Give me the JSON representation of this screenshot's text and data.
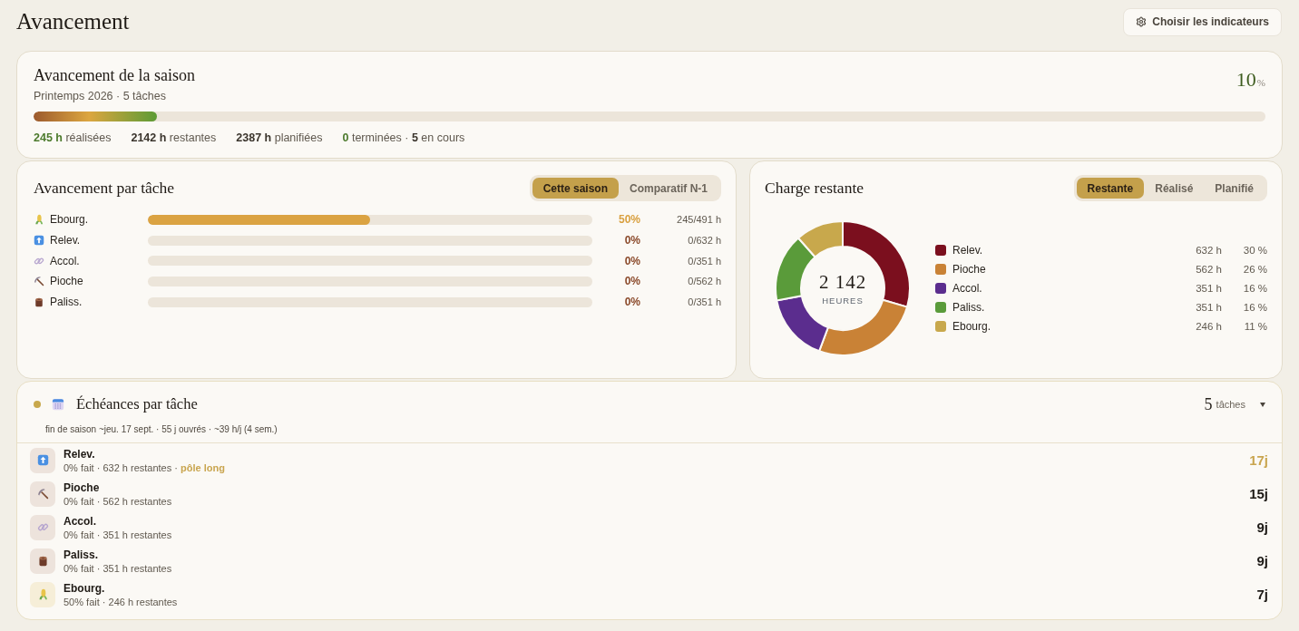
{
  "page": {
    "title": "Avancement",
    "action": "Choisir les indicateurs"
  },
  "season": {
    "title": "Avancement de la saison",
    "subtitle": "Printemps 2026 · 5 tâches",
    "percent": {
      "value": "10",
      "unit": "%"
    },
    "level": 0.1,
    "stats": [
      {
        "kind": "done",
        "text": "**245 h** réalisées"
      },
      {
        "kind": "plain",
        "text": "**2142 h** restantes"
      },
      {
        "kind": "plain",
        "text": "**2387 h** planifiées"
      },
      {
        "kind": "status",
        "text": "**0** terminées · **5** en cours"
      }
    ]
  },
  "task_progress": {
    "title": "Avancement par tâche",
    "tabs": [
      {
        "label": "Cette saison",
        "selected": true
      },
      {
        "label": "Comparatif N-1",
        "selected": false
      }
    ],
    "rows": [
      {
        "kind": "corn",
        "name": "Ebourg.",
        "level": 0.5,
        "percent": "50%",
        "hours": "245/491 h"
      },
      {
        "kind": "arrow",
        "name": "Relev.",
        "percent": "0%",
        "hours": "0/632 h"
      },
      {
        "kind": "link",
        "name": "Accol.",
        "percent": "0%",
        "hours": "0/351 h"
      },
      {
        "kind": "pickaxe",
        "name": "Pioche",
        "percent": "0%",
        "hours": "0/562 h"
      },
      {
        "kind": "log",
        "name": "Paliss.",
        "percent": "0%",
        "hours": "0/351 h"
      }
    ]
  },
  "remaining_load": {
    "title": "Charge restante",
    "tabs": [
      {
        "label": "Restante",
        "selected": true
      },
      {
        "label": "Réalisé",
        "selected": false
      },
      {
        "label": "Planifié",
        "selected": false
      }
    ],
    "total": "2 142",
    "total_unit": "HEURES",
    "legend": [
      {
        "color": "#7b0f1e",
        "hours": "632 h",
        "share": "30 %"
      },
      {
        "color": "#c98236",
        "hours": "562 h",
        "share": "26 %"
      },
      {
        "color": "#5b2d8e",
        "hours": "351 h",
        "share": "16 %"
      },
      {
        "color": "#5a9b3a",
        "hours": "351 h",
        "share": "16 %"
      },
      {
        "color": "#c8a84c",
        "hours": "246 h",
        "share": "11 %"
      }
    ],
    "chart_data": {
      "type": "donut",
      "categories": [
        "Relev.",
        "Pioche",
        "Accol.",
        "Paliss.",
        "Ebourg."
      ],
      "values": [
        29.5,
        26.2,
        16.4,
        16.4,
        11.5
      ]
    }
  },
  "deadlines": {
    "title": "Échéances par tâche",
    "subtitle": "fin de saison ~jeu. 17 sept. · 55 j ouvrés · ~39 h/j (4 sem.)",
    "count": {
      "value": "5",
      "unit": "tâches"
    },
    "expanded": true,
    "rows": [
      {
        "kind": "arrow",
        "name": "Relev.",
        "detail": "0% fait · 632 h restantes · **pôle long**",
        "days": "17j",
        "highlighted": true
      },
      {
        "kind": "pickaxe",
        "name": "Pioche",
        "detail": "0% fait · 562 h restantes",
        "days": "15j",
        "highlighted": false
      },
      {
        "kind": "link",
        "name": "Accol.",
        "detail": "0% fait · 351 h restantes",
        "days": "9j",
        "highlighted": false
      },
      {
        "kind": "log",
        "name": "Paliss.",
        "detail": "0% fait · 351 h restantes",
        "days": "9j",
        "highlighted": false
      },
      {
        "kind": "corn",
        "name": "Ebourg.",
        "detail": "50% fait · 246 h restantes",
        "days": "7j",
        "highlighted": false
      }
    ]
  }
}
